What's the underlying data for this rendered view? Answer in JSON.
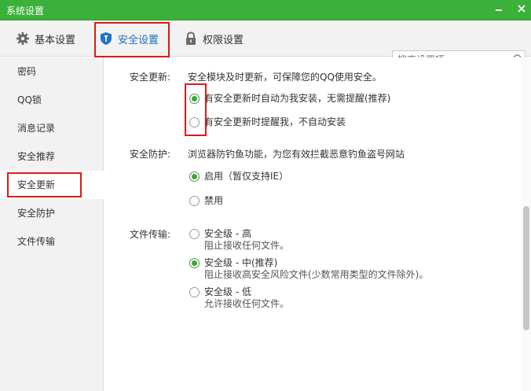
{
  "window": {
    "title": "系统设置"
  },
  "tabs": [
    {
      "label": "基本设置",
      "icon": "gear-icon"
    },
    {
      "label": "安全设置",
      "icon": "shield-icon",
      "active": true
    },
    {
      "label": "权限设置",
      "icon": "lock-icon"
    }
  ],
  "search": {
    "placeholder": "搜索设置项"
  },
  "sidebar": {
    "items": [
      {
        "label": "密码"
      },
      {
        "label": "QQ锁"
      },
      {
        "label": "消息记录"
      },
      {
        "label": "安全推荐"
      },
      {
        "label": "安全更新",
        "active": true
      },
      {
        "label": "安全防护"
      },
      {
        "label": "文件传输"
      }
    ]
  },
  "sections": {
    "update": {
      "label": "安全更新:",
      "desc": "安全模块及时更新，可保障您的QQ使用安全。",
      "options": [
        {
          "label": "有安全更新时自动为我安装，无需提醒(推荐)",
          "checked": true
        },
        {
          "label": "有安全更新时提醒我，不自动安装",
          "checked": false
        }
      ]
    },
    "protect": {
      "label": "安全防护:",
      "desc": "浏览器防钓鱼功能，为您有效拦截恶意钓鱼盗号网站",
      "options": [
        {
          "label": "启用（暂仅支持IE）",
          "checked": true
        },
        {
          "label": "禁用",
          "checked": false
        }
      ]
    },
    "transfer": {
      "label": "文件传输:",
      "options": [
        {
          "label": "安全级 - 高",
          "sub": "阻止接收任何文件。",
          "checked": false
        },
        {
          "label": "安全级 - 中(推荐)",
          "sub": "阻止接收高安全风险文件(少数常用类型的文件除外)。",
          "checked": true
        },
        {
          "label": "安全级 - 低",
          "sub": "允许接收任何文件。",
          "checked": false
        }
      ]
    }
  },
  "colors": {
    "titlebar": "#3bb13b",
    "accent": "#1a6fc4",
    "highlight": "#e01818",
    "radio_checked": "#3aa83a"
  }
}
